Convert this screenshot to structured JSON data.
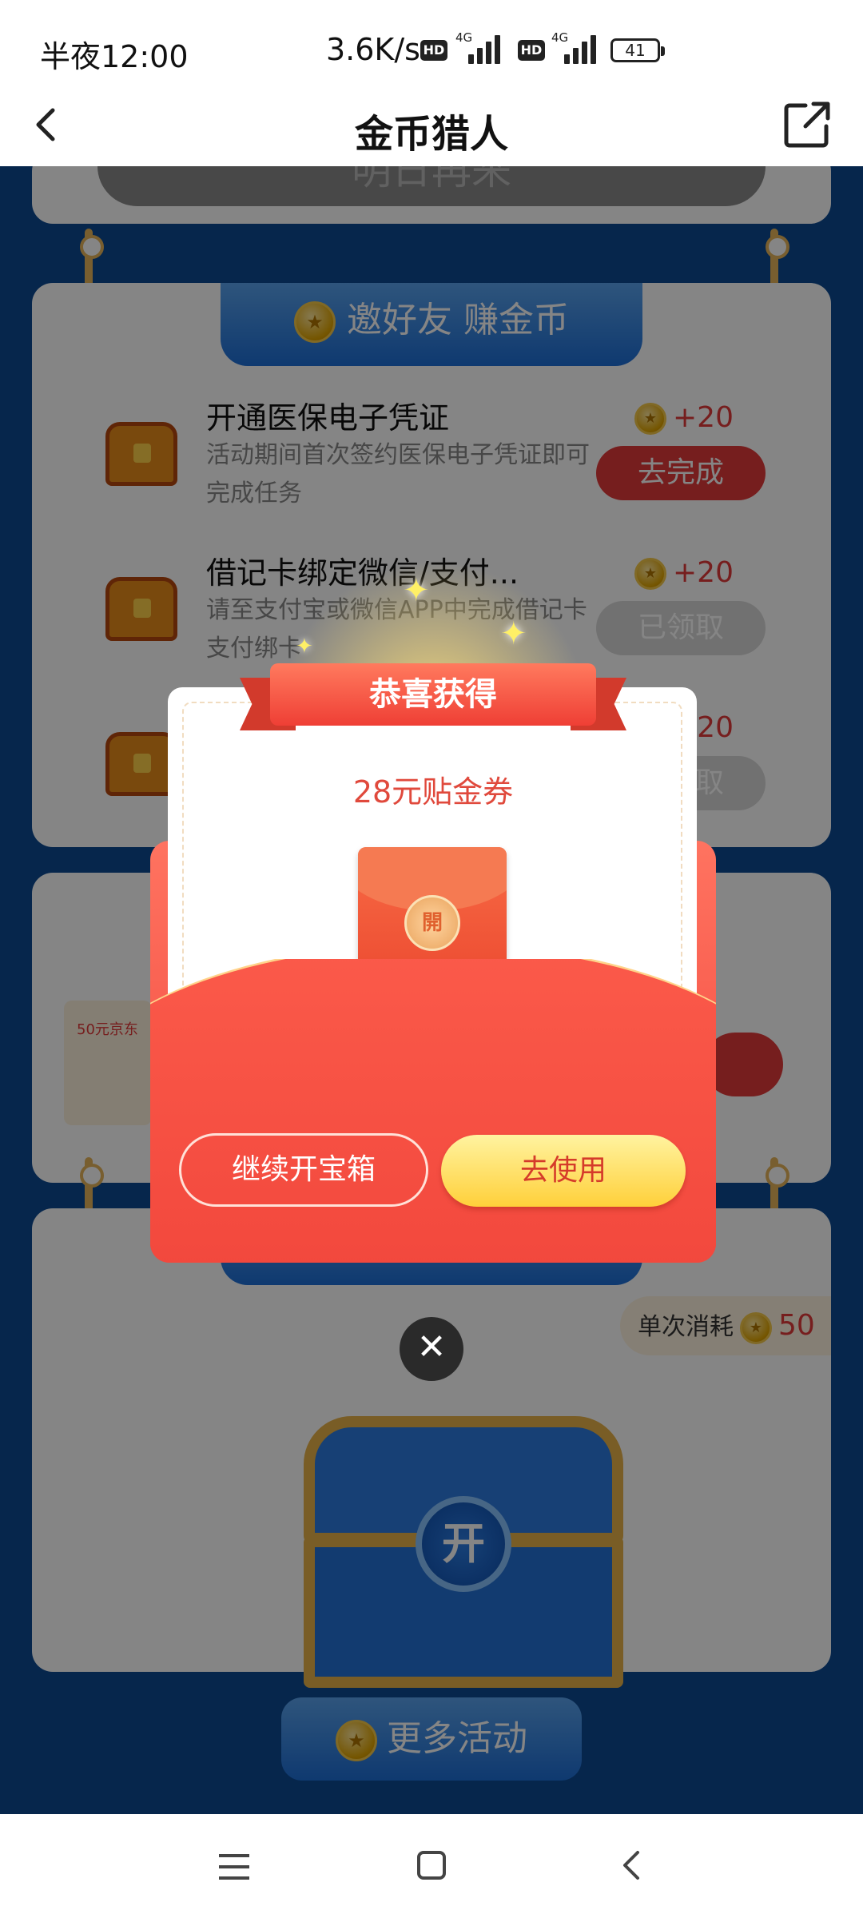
{
  "status_bar": {
    "time": "半夜12:00",
    "net_speed": "3.6K/s",
    "hd_label": "HD",
    "network_type": "4G",
    "battery": "41"
  },
  "header": {
    "title": "金币猎人",
    "back_icon": "chevron-left-icon",
    "share_icon": "share-icon"
  },
  "checkin_card": {
    "button_label": "明日再来"
  },
  "invite_section": {
    "tab_label": "邀好友 赚金币",
    "tasks": [
      {
        "title": "开通医保电子凭证",
        "desc": "活动期间首次签约医保电子凭证即可完成任务",
        "reward": "+20",
        "button": "去完成"
      },
      {
        "title": "借记卡绑定微信/支付...",
        "desc": "请至支付宝或微信APP中完成借记卡支付绑卡",
        "reward": "+20",
        "button": "已领取"
      },
      {
        "reward": "+20",
        "button": "已领取"
      }
    ]
  },
  "prize_card": {
    "prize_label": "50元京东"
  },
  "treasure_section": {
    "cost_label": "单次消耗",
    "cost_value": "50",
    "chest_label": "开"
  },
  "more_activities": {
    "label": "更多活动"
  },
  "modal": {
    "ribbon_title": "恭喜获得",
    "coupon_text": "28元贴金券",
    "seal_text": "開",
    "continue_button": "继续开宝箱",
    "use_button": "去使用",
    "close_icon": "close-icon"
  },
  "nav_bar": {
    "menu_icon": "menu-icon",
    "home_icon": "home-icon",
    "back_icon": "back-icon"
  },
  "colors": {
    "accent_red": "#e23a3a",
    "brand_blue": "#1d6ed6",
    "gold": "#e9b34a"
  }
}
